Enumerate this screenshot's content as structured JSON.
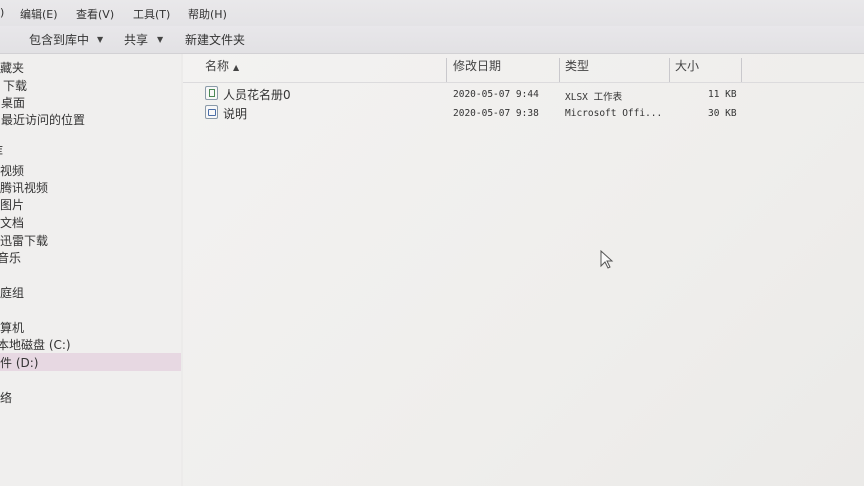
{
  "menu": {
    "items": [
      ")",
      "编辑(E)",
      "查看(V)",
      "工具(T)",
      "帮助(H)"
    ]
  },
  "toolbar": {
    "include_library": "包含到库中",
    "share": "共享",
    "new_folder": "新建文件夹"
  },
  "nav": {
    "items": [
      "收藏夹",
      "下载",
      "桌面",
      "最近访问的位置",
      "库",
      "视频",
      "腾讯视频",
      "图片",
      "文档",
      "迅雷下载",
      "音乐",
      "家庭组",
      "计算机",
      "本地磁盘 (C:)",
      "文件 (D:)",
      "网络"
    ]
  },
  "columns": {
    "name": "名称",
    "date": "修改日期",
    "type": "类型",
    "size": "大小"
  },
  "files": [
    {
      "name": "人员花名册0",
      "date": "2020-05-07  9:44",
      "type": "XLSX 工作表",
      "size": "11 KB",
      "icon": "excel-file-icon"
    },
    {
      "name": "说明",
      "date": "2020-05-07  9:38",
      "type": "Microsoft Offi...",
      "size": "30 KB",
      "icon": "word-file-icon"
    }
  ]
}
